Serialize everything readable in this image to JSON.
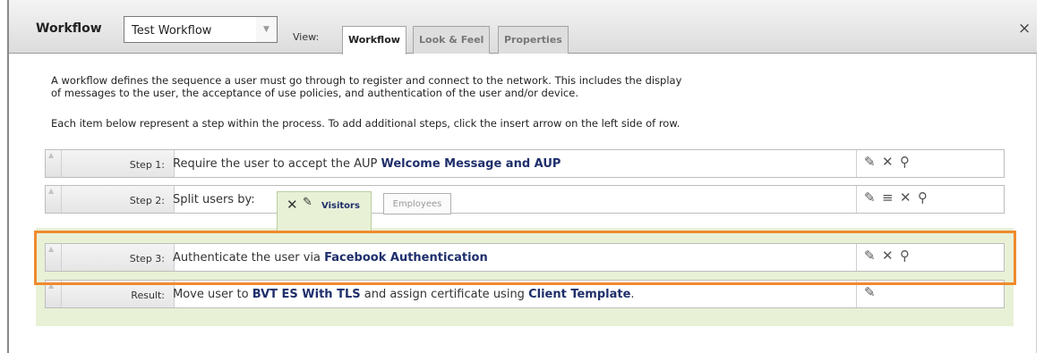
{
  "header": {
    "title": "Workflow",
    "select_value": "Test Workflow",
    "view_label": "View:",
    "tabs": [
      {
        "label": "Workflow"
      },
      {
        "label": "Look & Feel"
      },
      {
        "label": "Properties"
      }
    ],
    "close": "×"
  },
  "description": {
    "line1": "A workflow defines the sequence a user must go through to register and connect to the network. This includes the display",
    "line2": "of messages to the user, the acceptance of use policies, and authentication of the user and/or device.",
    "line3": "Each item below represent a step within the process. To add additional steps, click the insert arrow on the left side of row."
  },
  "steps": [
    {
      "label": "Step 1:",
      "text_prefix": "Require the user to accept the AUP",
      "text_bold": "Welcome Message and AUP"
    },
    {
      "label": "Step 2:",
      "text_prefix": "Split users by:",
      "branches": [
        {
          "label": "Visitors"
        },
        {
          "label": "Employees"
        }
      ]
    },
    {
      "label": "Step 3:",
      "text_prefix": "Authenticate the user via",
      "text_bold": "Facebook Authentication"
    },
    {
      "label": "Result:",
      "text_prefix": "Move user to",
      "text_bold1": "BVT ES With TLS",
      "text_mid": "and assign certificate using",
      "text_bold2": "Client Template",
      "text_end": "."
    }
  ],
  "icons": {
    "edit": "pencil-icon",
    "delete": "close-icon",
    "view": "magnifier-icon",
    "reorder": "list-icon"
  },
  "colors": {
    "accent_bold_text": "#1f2f6b",
    "highlight_border": "#f08a2e",
    "branch_background": "#e8f1d6"
  }
}
